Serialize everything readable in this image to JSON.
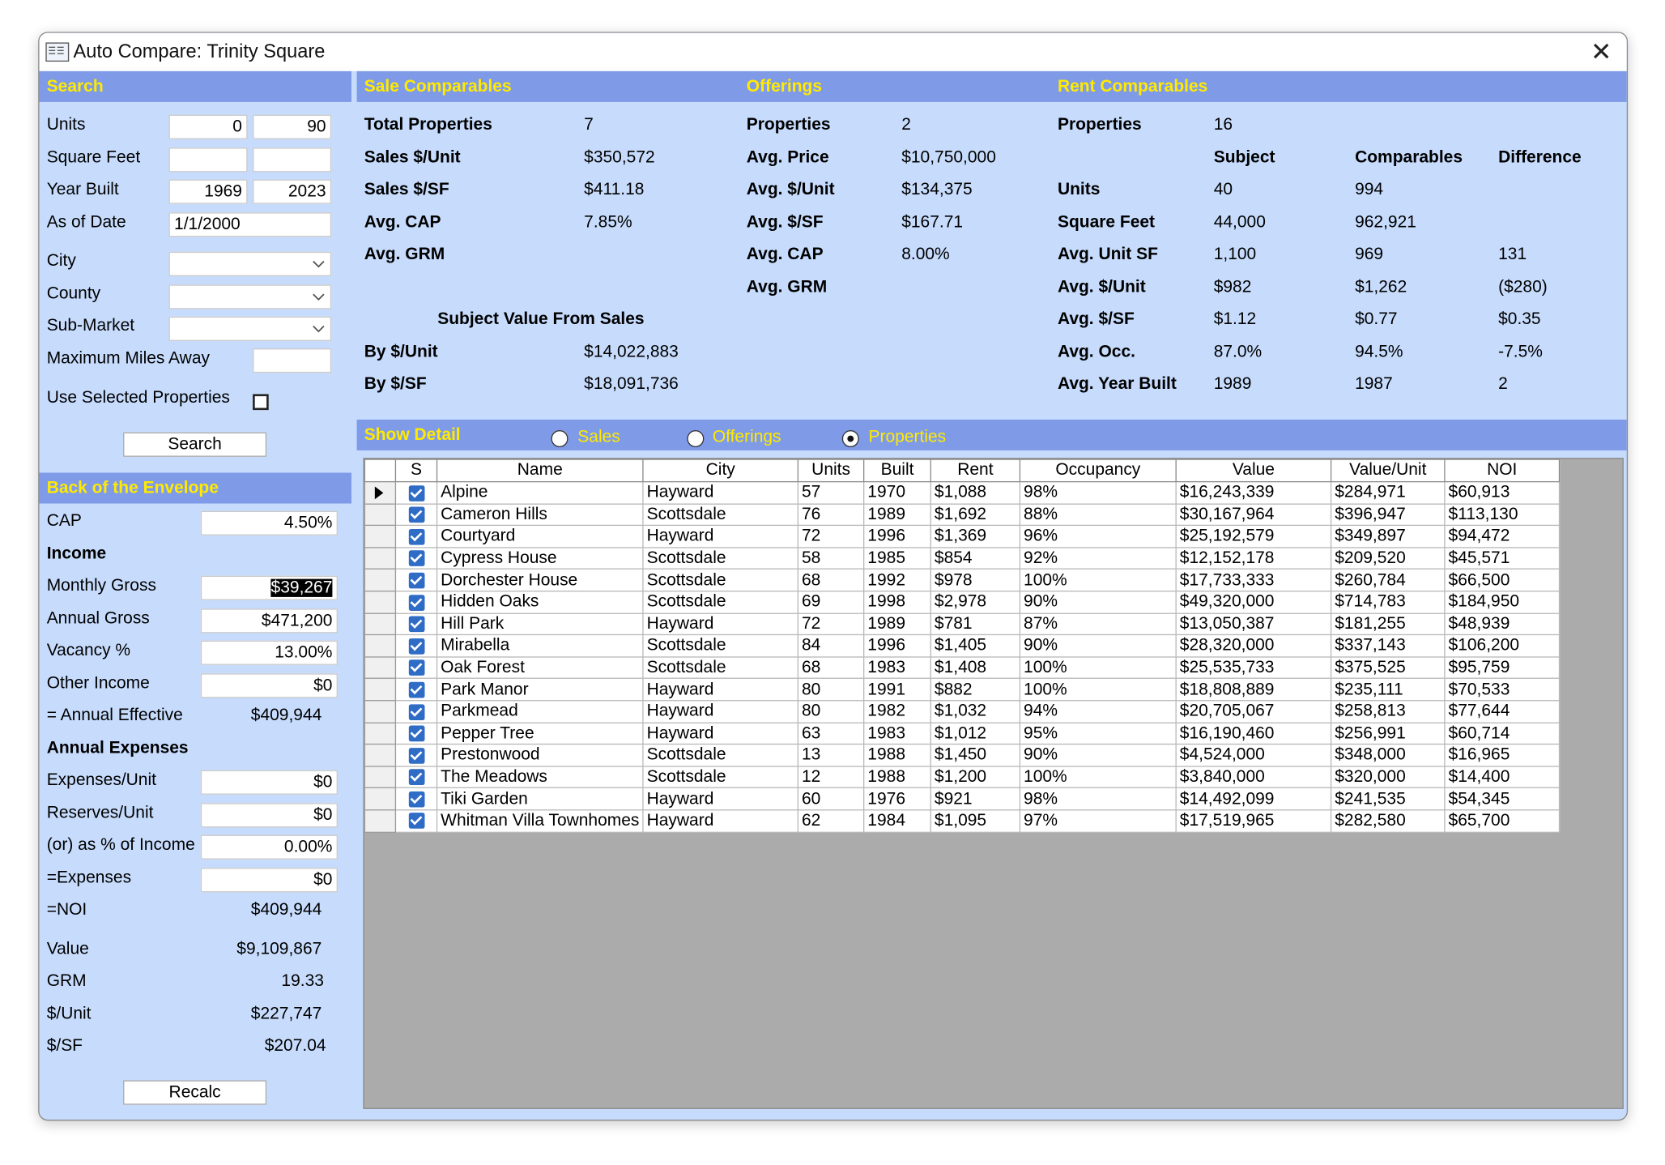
{
  "window": {
    "title": "Auto Compare: Trinity Square"
  },
  "search": {
    "header": "Search",
    "units_label": "Units",
    "units_min": "0",
    "units_max": "90",
    "sqft_label": "Square Feet",
    "sqft_min": "",
    "sqft_max": "",
    "year_label": "Year Built",
    "year_min": "1969",
    "year_max": "2023",
    "asof_label": "As of Date",
    "asof_value": "1/1/2000",
    "city_label": "City",
    "city_value": "",
    "county_label": "County",
    "county_value": "",
    "submarket_label": "Sub-Market",
    "submarket_value": "",
    "miles_label": "Maximum Miles Away",
    "miles_value": "",
    "use_selected_label": "Use Selected Properties",
    "use_selected_checked": false,
    "search_button": "Search"
  },
  "envelope": {
    "header": "Back of the Envelope",
    "cap_label": "CAP",
    "cap_value": "4.50%",
    "income_heading": "Income",
    "monthly_gross_label": "Monthly Gross",
    "monthly_gross_value": "$39,267",
    "annual_gross_label": "Annual Gross",
    "annual_gross_value": "$471,200",
    "vacancy_label": "Vacancy %",
    "vacancy_value": "13.00%",
    "other_income_label": "Other Income",
    "other_income_value": "$0",
    "annual_effective_label": "= Annual Effective",
    "annual_effective_value": "$409,944",
    "expenses_heading": "Annual Expenses",
    "exp_unit_label": "Expenses/Unit",
    "exp_unit_value": "$0",
    "reserves_label": "Reserves/Unit",
    "reserves_value": "$0",
    "pct_income_label": "(or) as % of Income",
    "pct_income_value": "0.00%",
    "expenses_label": "=Expenses",
    "expenses_value": "$0",
    "noi_label": "=NOI",
    "noi_value": "$409,944",
    "value_label": "Value",
    "value_value": "$9,109,867",
    "grm_label": "GRM",
    "grm_value": "19.33",
    "per_unit_label": "$/Unit",
    "per_unit_value": "$227,747",
    "per_sf_label": "$/SF",
    "per_sf_value": "$207.04",
    "recalc_button": "Recalc"
  },
  "sale": {
    "header": "Sale Comparables",
    "total_label": "Total Properties",
    "total_value": "7",
    "per_unit_label": "Sales $/Unit",
    "per_unit_value": "$350,572",
    "per_sf_label": "Sales $/SF",
    "per_sf_value": "$411.18",
    "cap_label": "Avg. CAP",
    "cap_value": "7.85%",
    "grm_label": "Avg. GRM",
    "grm_value": "",
    "subject_heading": "Subject Value From Sales",
    "by_unit_label": "By $/Unit",
    "by_unit_value": "$14,022,883",
    "by_sf_label": "By $/SF",
    "by_sf_value": "$18,091,736"
  },
  "offerings": {
    "header": "Offerings",
    "props_label": "Properties",
    "props_value": "2",
    "price_label": "Avg. Price",
    "price_value": "$10,750,000",
    "unit_label": "Avg. $/Unit",
    "unit_value": "$134,375",
    "sf_label": "Avg. $/SF",
    "sf_value": "$167.71",
    "cap_label": "Avg. CAP",
    "cap_value": "8.00%",
    "grm_label": "Avg. GRM",
    "grm_value": ""
  },
  "rent": {
    "header": "Rent Comparables",
    "props_label": "Properties",
    "props_value": "16",
    "col_subject": "Subject",
    "col_comps": "Comparables",
    "col_diff": "Difference",
    "rows": [
      {
        "label": "Units",
        "subject": "40",
        "comps": "994",
        "diff": ""
      },
      {
        "label": "Square Feet",
        "subject": "44,000",
        "comps": "962,921",
        "diff": ""
      },
      {
        "label": "Avg. Unit SF",
        "subject": "1,100",
        "comps": "969",
        "diff": "131"
      },
      {
        "label": "Avg. $/Unit",
        "subject": "$982",
        "comps": "$1,262",
        "diff": "($280)"
      },
      {
        "label": "Avg. $/SF",
        "subject": "$1.12",
        "comps": "$0.77",
        "diff": "$0.35"
      },
      {
        "label": "Avg. Occ.",
        "subject": "87.0%",
        "comps": "94.5%",
        "diff": "-7.5%"
      },
      {
        "label": "Avg. Year Built",
        "subject": "1989",
        "comps": "1987",
        "diff": "2"
      }
    ]
  },
  "detail": {
    "header": "Show Detail",
    "opt_sales": "Sales",
    "opt_offerings": "Offerings",
    "opt_properties": "Properties",
    "selected": "Properties"
  },
  "grid": {
    "columns": [
      "S",
      "Name",
      "City",
      "Units",
      "Built",
      "Rent",
      "Occupancy",
      "Value",
      "Value/Unit",
      "NOI"
    ],
    "rows": [
      [
        "Alpine",
        "Hayward",
        "57",
        "1970",
        "$1,088",
        "98%",
        "$16,243,339",
        "$284,971",
        "$60,913"
      ],
      [
        "Cameron Hills",
        "Scottsdale",
        "76",
        "1989",
        "$1,692",
        "88%",
        "$30,167,964",
        "$396,947",
        "$113,130"
      ],
      [
        "Courtyard",
        "Hayward",
        "72",
        "1996",
        "$1,369",
        "96%",
        "$25,192,579",
        "$349,897",
        "$94,472"
      ],
      [
        "Cypress House",
        "Scottsdale",
        "58",
        "1985",
        "$854",
        "92%",
        "$12,152,178",
        "$209,520",
        "$45,571"
      ],
      [
        "Dorchester House",
        "Scottsdale",
        "68",
        "1992",
        "$978",
        "100%",
        "$17,733,333",
        "$260,784",
        "$66,500"
      ],
      [
        "Hidden Oaks",
        "Scottsdale",
        "69",
        "1998",
        "$2,978",
        "90%",
        "$49,320,000",
        "$714,783",
        "$184,950"
      ],
      [
        "Hill Park",
        "Hayward",
        "72",
        "1989",
        "$781",
        "87%",
        "$13,050,387",
        "$181,255",
        "$48,939"
      ],
      [
        "Mirabella",
        "Scottsdale",
        "84",
        "1996",
        "$1,405",
        "90%",
        "$28,320,000",
        "$337,143",
        "$106,200"
      ],
      [
        "Oak Forest",
        "Scottsdale",
        "68",
        "1983",
        "$1,408",
        "100%",
        "$25,535,733",
        "$375,525",
        "$95,759"
      ],
      [
        "Park Manor",
        "Hayward",
        "80",
        "1991",
        "$882",
        "100%",
        "$18,808,889",
        "$235,111",
        "$70,533"
      ],
      [
        "Parkmead",
        "Hayward",
        "80",
        "1982",
        "$1,032",
        "94%",
        "$20,705,067",
        "$258,813",
        "$77,644"
      ],
      [
        "Pepper Tree",
        "Hayward",
        "63",
        "1983",
        "$1,012",
        "95%",
        "$16,190,460",
        "$256,991",
        "$60,714"
      ],
      [
        "Prestonwood",
        "Scottsdale",
        "13",
        "1988",
        "$1,450",
        "90%",
        "$4,524,000",
        "$348,000",
        "$16,965"
      ],
      [
        "The Meadows",
        "Scottsdale",
        "12",
        "1988",
        "$1,200",
        "100%",
        "$3,840,000",
        "$320,000",
        "$14,400"
      ],
      [
        "Tiki Garden",
        "Hayward",
        "60",
        "1976",
        "$921",
        "98%",
        "$14,492,099",
        "$241,535",
        "$54,345"
      ],
      [
        "Whitman Villa Townhomes",
        "Hayward",
        "62",
        "1984",
        "$1,095",
        "97%",
        "$17,519,965",
        "$282,580",
        "$65,700"
      ]
    ]
  }
}
